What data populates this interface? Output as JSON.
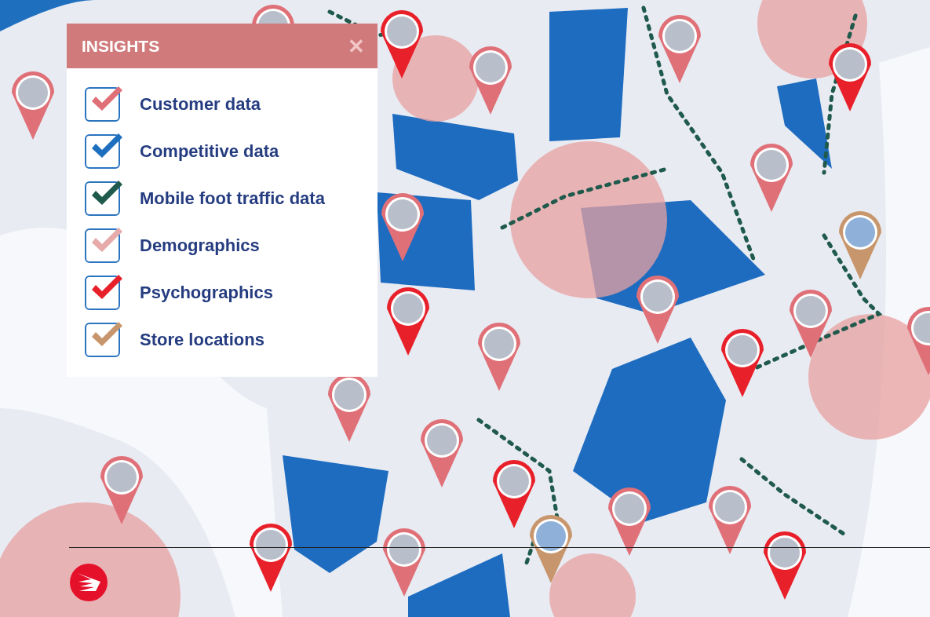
{
  "panel": {
    "title": "INSIGHTS",
    "close": "✕"
  },
  "layers": [
    {
      "label": "Customer data",
      "checked": true,
      "color": "#e07078"
    },
    {
      "label": "Competitive data",
      "checked": true,
      "color": "#1f6fbf"
    },
    {
      "label": "Mobile foot traffic data",
      "checked": true,
      "color": "#1f5a4c"
    },
    {
      "label": "Demographics",
      "checked": true,
      "color": "#e6aaaa"
    },
    {
      "label": "Psychographics",
      "checked": true,
      "color": "#e8202a"
    },
    {
      "label": "Store locations",
      "checked": true,
      "color": "#c8966c"
    }
  ]
}
